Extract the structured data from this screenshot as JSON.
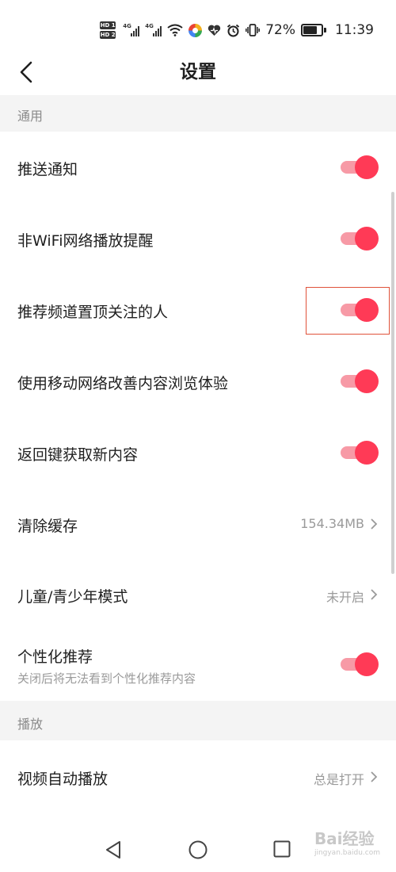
{
  "status_bar": {
    "hd1": "HD 1",
    "hd2": "HD 2",
    "net1": "4G",
    "net2": "4G",
    "battery": "72%",
    "time": "11:39",
    "icons": [
      "wifi-icon",
      "colorful-app-icon",
      "heart-icon",
      "alarm-icon",
      "vibrate-icon",
      "battery-icon"
    ]
  },
  "header": {
    "title": "设置"
  },
  "sections": {
    "general": "通用",
    "playback": "播放"
  },
  "settings": {
    "push": {
      "label": "推送通知",
      "on": true
    },
    "nonwifi": {
      "label": "非WiFi网络播放提醒",
      "on": true
    },
    "pin_follow": {
      "label": "推荐频道置顶关注的人",
      "on": true
    },
    "mobile_net": {
      "label": "使用移动网络改善内容浏览体验",
      "on": true
    },
    "back_refresh": {
      "label": "返回键获取新内容",
      "on": true
    },
    "clear_cache": {
      "label": "清除缓存",
      "value": "154.34MB"
    },
    "kids_mode": {
      "label": "儿童/青少年模式",
      "value": "未开启"
    },
    "personalized": {
      "label": "个性化推荐",
      "sub": "关闭后将无法看到个性化推荐内容",
      "on": true
    },
    "autoplay": {
      "label": "视频自动播放",
      "value": "总是打开"
    }
  },
  "watermark": {
    "text": "Bai经验",
    "url": "jingyan.baidu.com"
  },
  "colors": {
    "accent": "#ff3a56",
    "track": "#f79aa6",
    "section_bg": "#f4f4f4"
  }
}
